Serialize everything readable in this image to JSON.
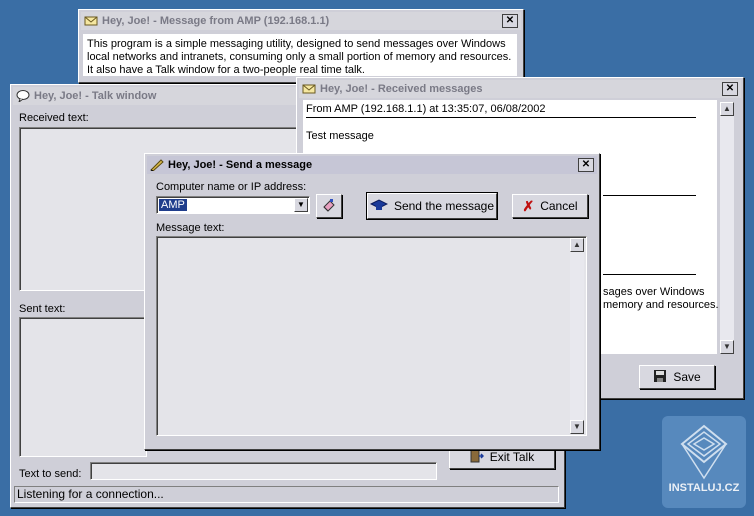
{
  "about_window": {
    "title": "Hey, Joe!  -  Message from AMP (192.168.1.1)",
    "body": "This program is a simple messaging utility, designed to send messages over Windows local networks and intranets, consuming only a small portion of memory and resources. It also have a Talk window for a two-people real time talk."
  },
  "talk_window": {
    "title": "Hey, Joe! - Talk window",
    "received_label": "Received text:",
    "sent_label": "Sent text:",
    "text_to_send_label": "Text to send:",
    "text_to_send_value": "",
    "exit_talk_label": "Exit Talk",
    "status": "Listening for a connection..."
  },
  "received_window": {
    "title": "Hey, Joe!  -  Received messages",
    "header": "From AMP (192.168.1.1) at 13:35:07, 06/08/2002",
    "message": "Test message",
    "partial_text_line1": "sages over Windows",
    "partial_text_line2": "memory and resources.",
    "save_label": "Save"
  },
  "send_window": {
    "title": "Hey, Joe!  -  Send a message",
    "computer_label": "Computer name or IP address:",
    "computer_value": "AMP",
    "send_label": "Send the message",
    "cancel_label": "Cancel",
    "message_label": "Message text:",
    "message_value": ""
  },
  "watermark": {
    "text": "INSTALUJ.CZ"
  },
  "colors": {
    "desktop": "#3a6ea5",
    "window_face": "#cfcfd8",
    "field": "#e4e4e9",
    "selection": "#1f3d8c"
  }
}
